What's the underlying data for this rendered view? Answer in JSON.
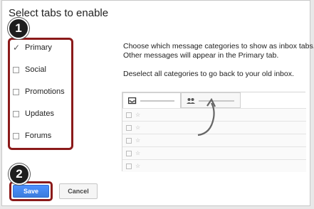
{
  "dialog": {
    "title": "Select tabs to enable",
    "categories": [
      {
        "label": "Primary",
        "checked": true
      },
      {
        "label": "Social",
        "checked": false
      },
      {
        "label": "Promotions",
        "checked": false
      },
      {
        "label": "Updates",
        "checked": false
      },
      {
        "label": "Forums",
        "checked": false
      }
    ],
    "description_lines": [
      "Choose which message categories to show as inbox tabs.",
      "Other messages will appear in the Primary tab.",
      "Deselect all categories to go back to your old inbox."
    ],
    "save_label": "Save",
    "cancel_label": "Cancel"
  },
  "annotations": {
    "step1": "1",
    "step2": "2",
    "highlight_color": "#8b1a1a"
  },
  "preview": {
    "tab1_icon": "inbox-icon",
    "tab2_icon": "people-icon",
    "row_icon": "star-icon",
    "row_count": 5
  },
  "colors": {
    "save_button": "#4d90fe",
    "badge": "#1e1e1e"
  }
}
